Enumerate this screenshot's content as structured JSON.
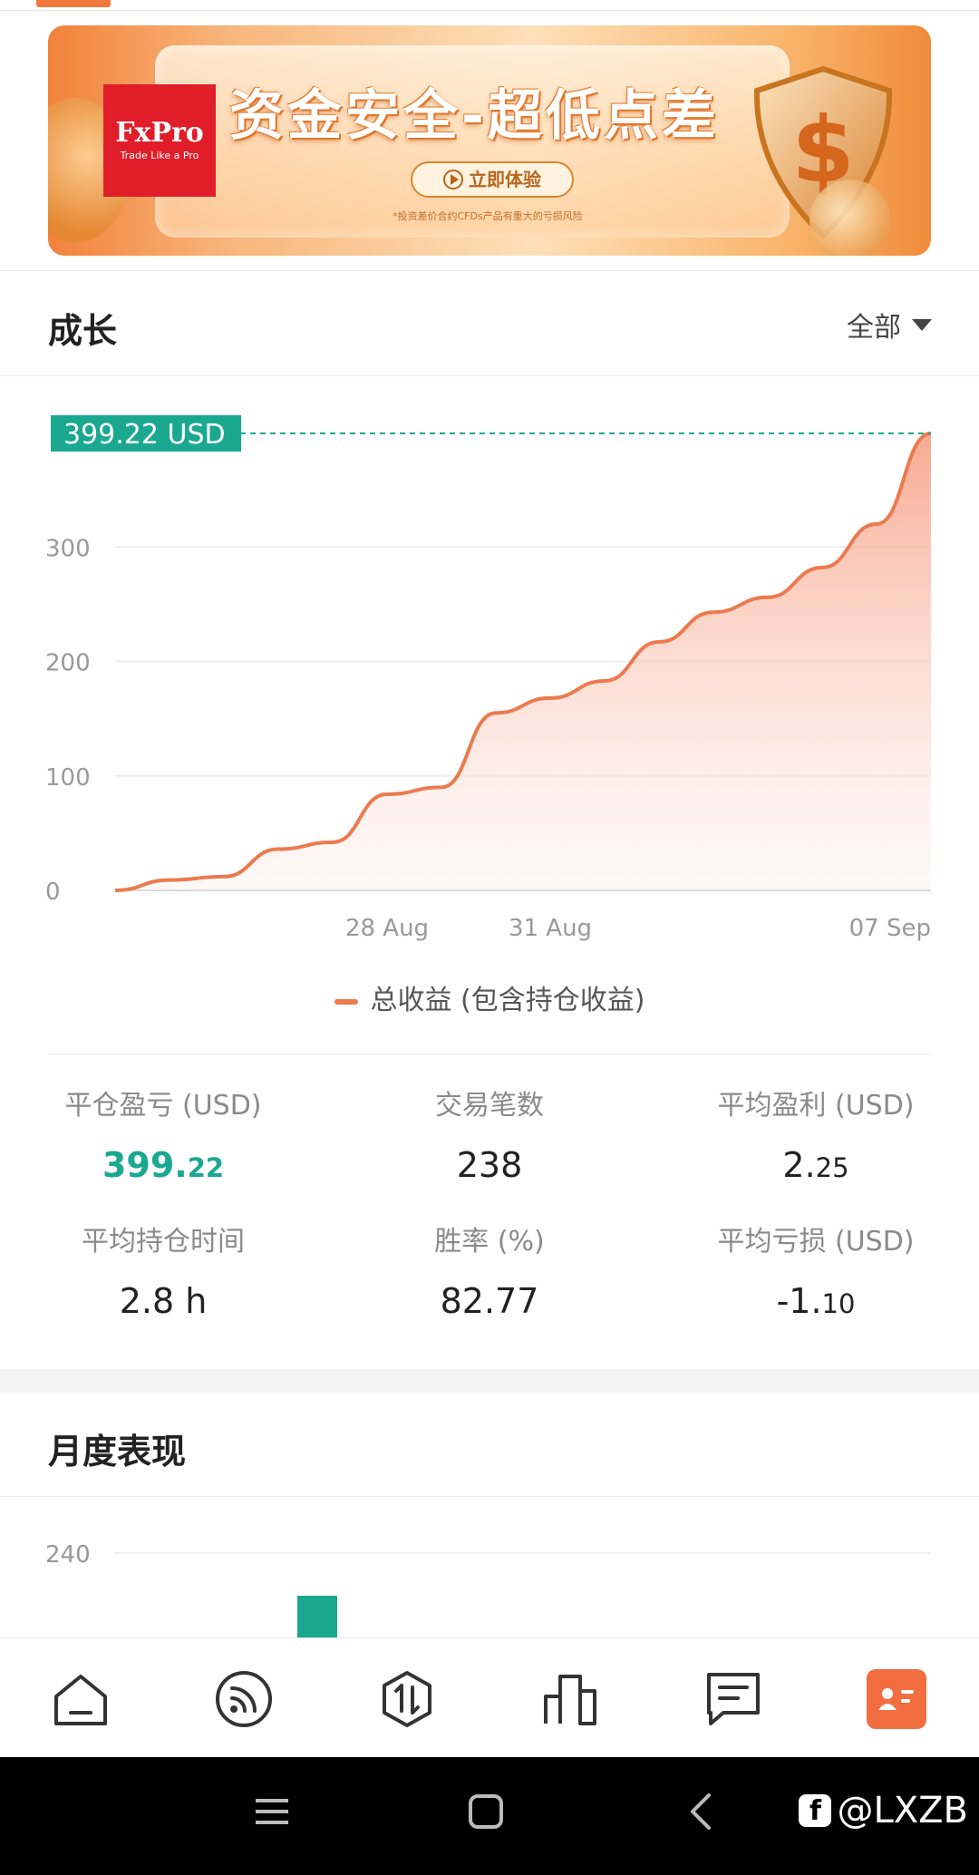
{
  "banner": {
    "brand": "FxPro",
    "tagline": "Trade Like a Pro",
    "headline": "资金安全-超低点差",
    "cta": "立即体验",
    "disclaimer": "*投资差价合约CFDs产品有重大的亏损风险",
    "brand_color": "#e11d2a"
  },
  "growth": {
    "title": "成长",
    "filter": "全部"
  },
  "chart_data": {
    "type": "area",
    "x": [
      "2023-08-23",
      "2023-08-24",
      "2023-08-25",
      "2023-08-26",
      "2023-08-27",
      "2023-08-28",
      "2023-08-29",
      "2023-08-30",
      "2023-08-31",
      "2023-09-01",
      "2023-09-02",
      "2023-09-03",
      "2023-09-04",
      "2023-09-05",
      "2023-09-06",
      "2023-09-07"
    ],
    "series": [
      {
        "name": "总收益 (包含持仓收益)",
        "values": [
          0,
          9,
          12,
          36,
          42,
          84,
          90,
          155,
          168,
          183,
          217,
          243,
          256,
          282,
          320,
          399.22
        ]
      }
    ],
    "xticks": [
      "28 Aug",
      "31 Aug",
      "07 Sep"
    ],
    "yticks": [
      0,
      100,
      200,
      300
    ],
    "ylim": [
      0,
      399.22
    ],
    "last_value_label": "399.22 USD",
    "line_color": "#ec7a4f",
    "marker_color": "#1aa890",
    "grid": true,
    "legend": "bottom"
  },
  "stats": [
    {
      "label": "平仓盈亏 (USD)",
      "value_int": "399.",
      "value_dec": "22",
      "highlight": true
    },
    {
      "label": "交易笔数",
      "value_int": "238",
      "value_dec": "",
      "highlight": false
    },
    {
      "label": "平均盈利 (USD)",
      "value_int": "2.",
      "value_dec": "25",
      "highlight": false
    },
    {
      "label": "平均持仓时间",
      "value_int": "2.8 h",
      "value_dec": "",
      "highlight": false
    },
    {
      "label": "胜率 (%)",
      "value_int": "82.77",
      "value_dec": "",
      "highlight": false
    },
    {
      "label": "平均亏损 (USD)",
      "value_int": "-1.",
      "value_dec": "10",
      "highlight": false
    }
  ],
  "monthly": {
    "title": "月度表现",
    "ytick": "240",
    "bar_color": "#1aa890"
  },
  "nav": {
    "items": [
      {
        "icon": "home-icon"
      },
      {
        "icon": "feed-icon"
      },
      {
        "icon": "trade-icon"
      },
      {
        "icon": "ranking-icon"
      },
      {
        "icon": "messages-icon"
      },
      {
        "icon": "profile-card-icon",
        "active": true
      }
    ],
    "active_color": "#f26d3f"
  },
  "system_bar": {
    "watermark": "@LXZB"
  }
}
